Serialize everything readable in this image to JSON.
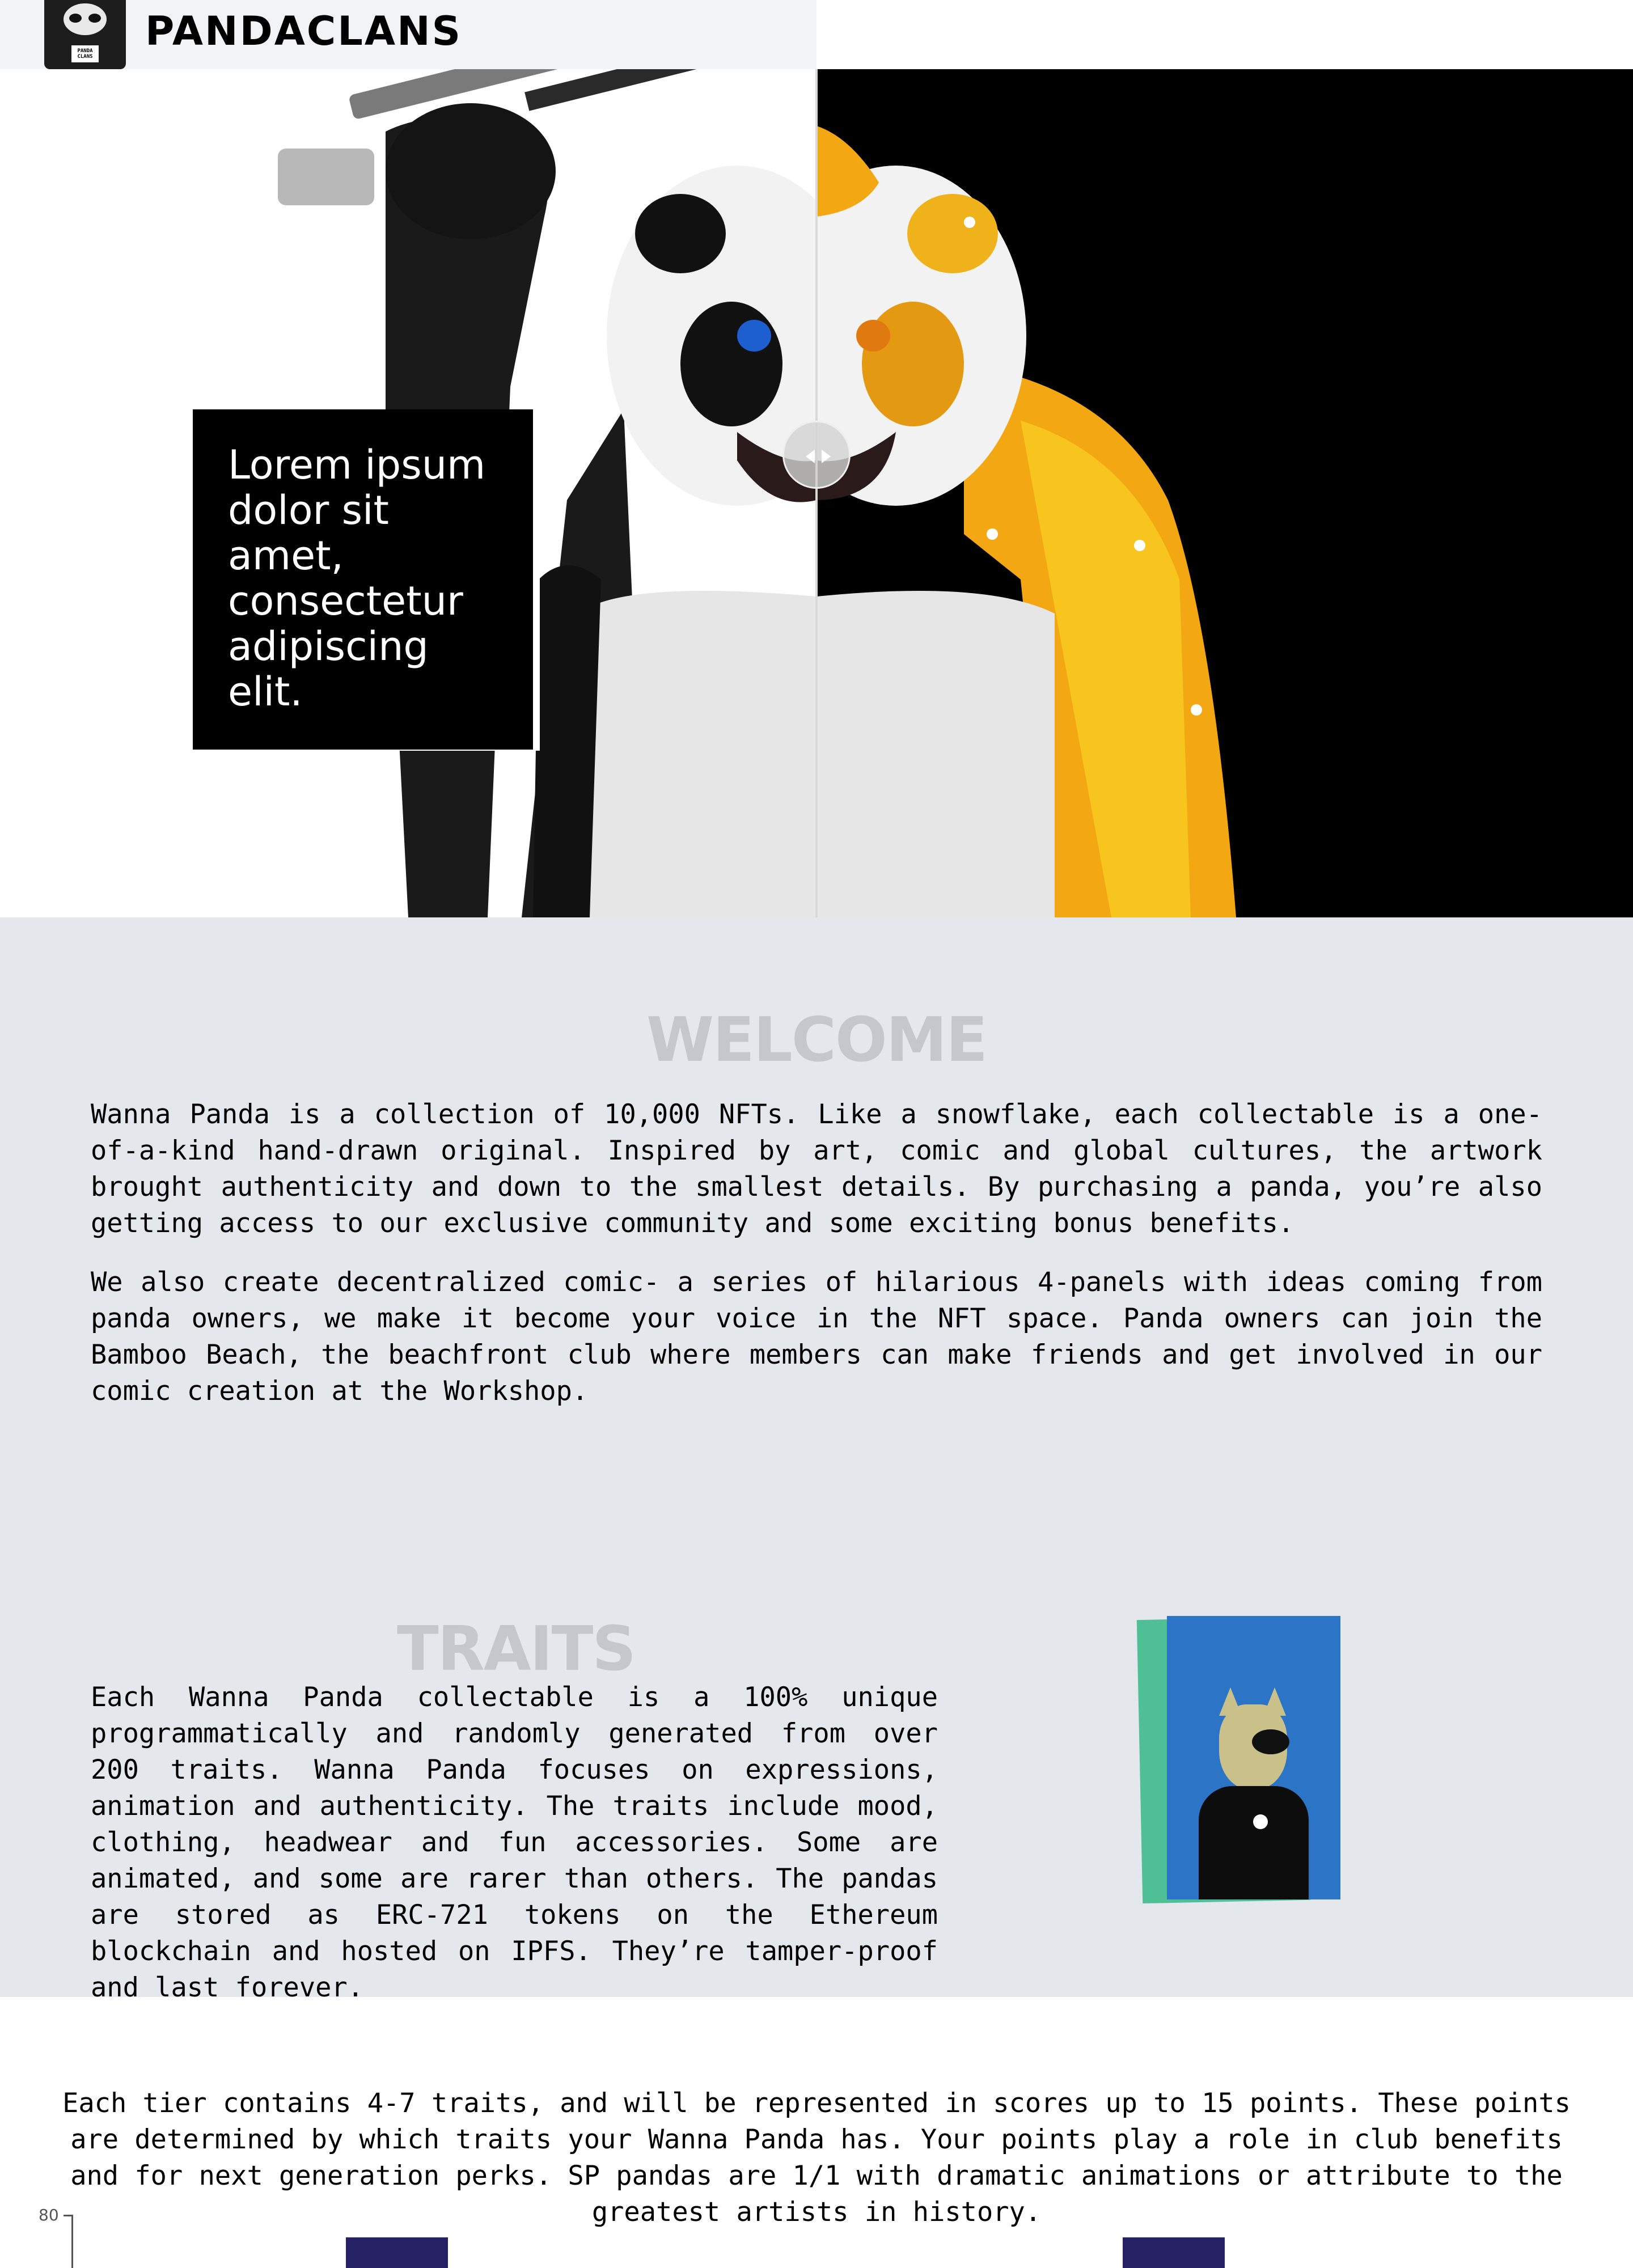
{
  "header": {
    "brand": "PANDACLANS",
    "logo_shirt_text": "PANDA CLANS",
    "icons": [
      "moon-icon",
      "user-icon",
      "menu-icon"
    ]
  },
  "hero": {
    "quote": "Lorem ipsum dolor sit amet, consectetur adipiscing elit.",
    "left_bg": "#ffffff",
    "right_bg": "#000000",
    "accent_gold": "#f2a713"
  },
  "welcome": {
    "title": "WELCOME",
    "p1": "Wanna Panda is a collection of 10,000 NFTs. Like a snowflake, each collectable is a one-of-a-kind hand-drawn original. Inspired by art, comic and global cultures, the artwork brought authenticity and down to the smallest details. By purchasing a panda, you’re also getting access to our exclusive community and some exciting bonus benefits.",
    "p2": "We also create decentralized comic- a series of hilarious 4-panels with ideas coming from panda owners, we make it become your voice in the NFT space. Panda owners can join the Bamboo Beach, the beachfront club where members can make friends and get involved in our comic creation at the Workshop.",
    "bg": "#e4e7eb"
  },
  "traits": {
    "title": "TRAITS",
    "text": "Each Wanna Panda collectable is a 100% unique programmatically and randomly generated from over 200 traits. Wanna Panda focuses on expressions, animation and authenticity. The traits include mood, clothing, headwear and fun accessories. Some are animated, and some are rarer than others. The pandas are stored as ERC-721 tokens on the Ethereum blockchain and hosted on IPFS. They’re tamper-proof and last forever."
  },
  "tiers": {
    "text": "Each tier contains 4-7 traits, and will be represented in scores up to 15 points. These points are determined by which traits your Wanna Panda has. Your points play a role in club benefits and for next generation perks. SP pandas are 1/1 with dramatic animations or attribute to the greatest artists in history.",
    "axis_top_label": "80",
    "bar_color": "#262064"
  }
}
